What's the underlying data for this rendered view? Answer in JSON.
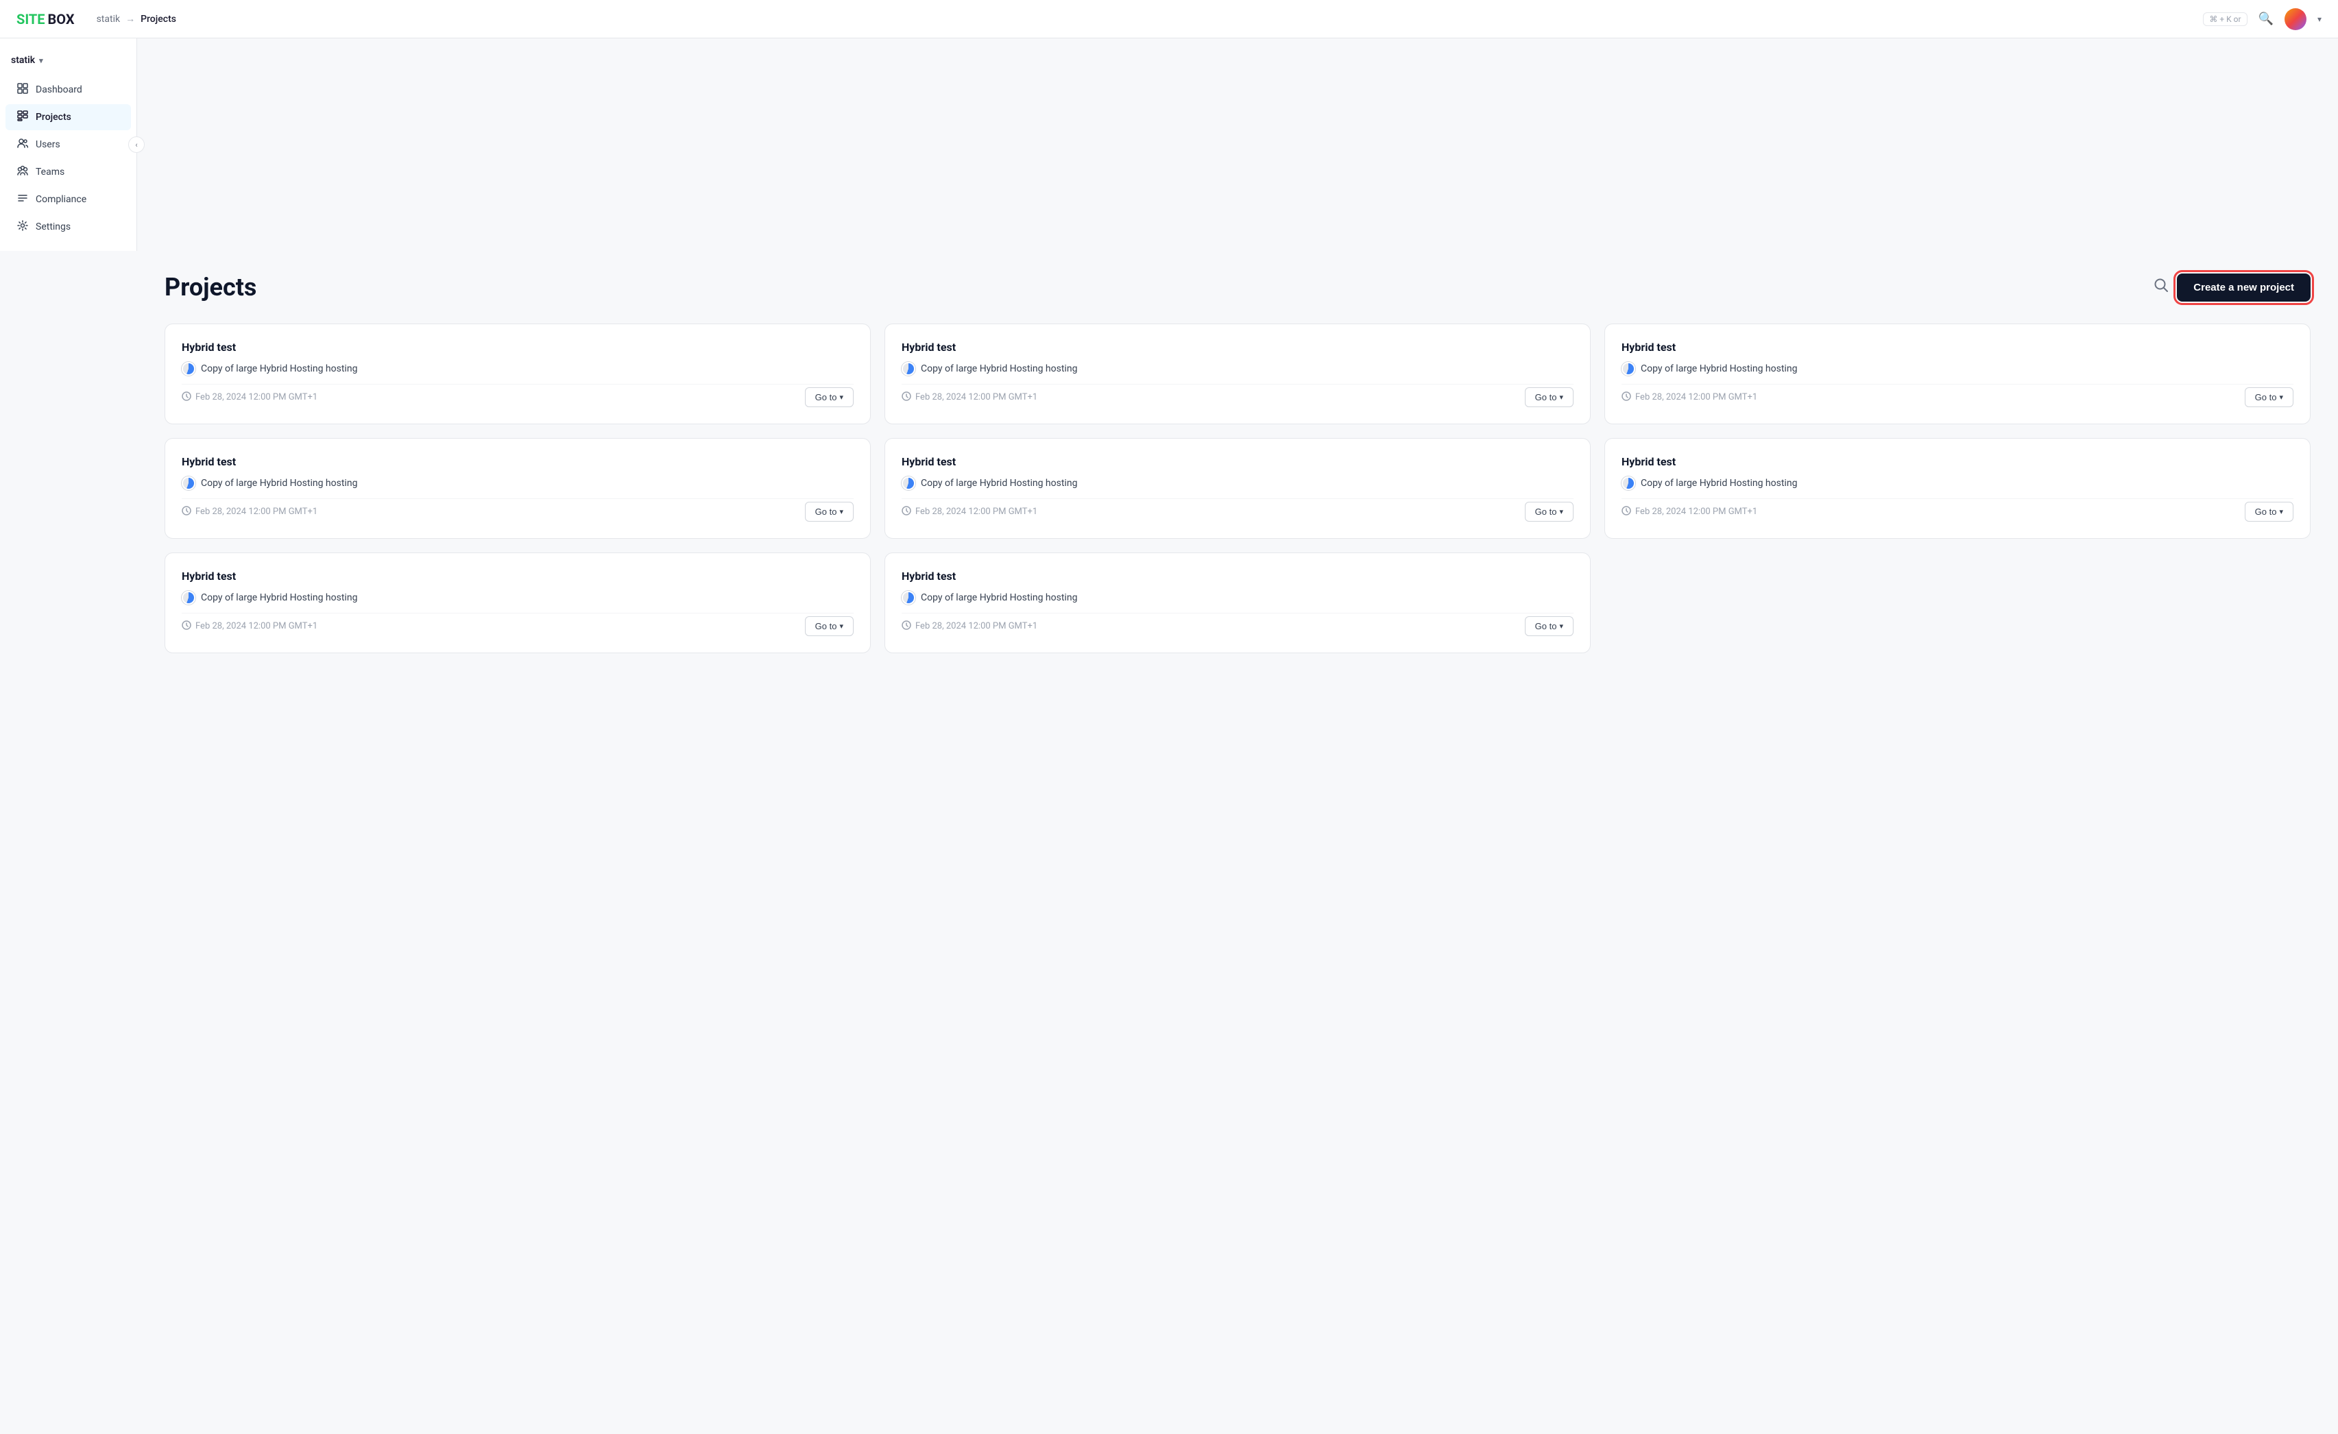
{
  "logo": {
    "site": "SITE",
    "box": "BOX"
  },
  "topnav": {
    "workspace": "statik",
    "breadcrumb_sep": "→",
    "breadcrumb_current": "Projects",
    "kbd_hint": "⌘ + K or",
    "search_aria": "Search"
  },
  "sidebar": {
    "workspace_label": "statik",
    "items": [
      {
        "id": "dashboard",
        "label": "Dashboard",
        "icon": "⊙",
        "active": false
      },
      {
        "id": "projects",
        "label": "Projects",
        "icon": "▦",
        "active": true
      },
      {
        "id": "users",
        "label": "Users",
        "icon": "○",
        "active": false
      },
      {
        "id": "teams",
        "label": "Teams",
        "icon": "◎",
        "active": false
      },
      {
        "id": "compliance",
        "label": "Compliance",
        "icon": "≡",
        "active": false
      },
      {
        "id": "settings",
        "label": "Settings",
        "icon": "✧",
        "active": false
      }
    ],
    "collapse_label": "‹"
  },
  "page": {
    "title": "Projects",
    "create_button": "Create a new project",
    "search_aria": "Search projects"
  },
  "projects": [
    {
      "id": 1,
      "name": "Hybrid test",
      "hosting": "Copy of large Hybrid Hosting hosting",
      "date": "Feb 28, 2024 12:00 PM GMT+1",
      "goto_label": "Go to"
    },
    {
      "id": 2,
      "name": "Hybrid test",
      "hosting": "Copy of large Hybrid Hosting hosting",
      "date": "Feb 28, 2024 12:00 PM GMT+1",
      "goto_label": "Go to"
    },
    {
      "id": 3,
      "name": "Hybrid test",
      "hosting": "Copy of large Hybrid Hosting hosting",
      "date": "Feb 28, 2024 12:00 PM GMT+1",
      "goto_label": "Go to"
    },
    {
      "id": 4,
      "name": "Hybrid test",
      "hosting": "Copy of large Hybrid Hosting hosting",
      "date": "Feb 28, 2024 12:00 PM GMT+1",
      "goto_label": "Go to"
    },
    {
      "id": 5,
      "name": "Hybrid test",
      "hosting": "Copy of large Hybrid Hosting hosting",
      "date": "Feb 28, 2024 12:00 PM GMT+1",
      "goto_label": "Go to"
    },
    {
      "id": 6,
      "name": "Hybrid test",
      "hosting": "Copy of large Hybrid Hosting hosting",
      "date": "Feb 28, 2024 12:00 PM GMT+1",
      "goto_label": "Go to"
    },
    {
      "id": 7,
      "name": "Hybrid test",
      "hosting": "Copy of large Hybrid Hosting hosting",
      "date": "Feb 28, 2024 12:00 PM GMT+1",
      "goto_label": "Go to"
    },
    {
      "id": 8,
      "name": "Hybrid test",
      "hosting": "Copy of large Hybrid Hosting hosting",
      "date": "Feb 28, 2024 12:00 PM GMT+1",
      "goto_label": "Go to"
    }
  ]
}
